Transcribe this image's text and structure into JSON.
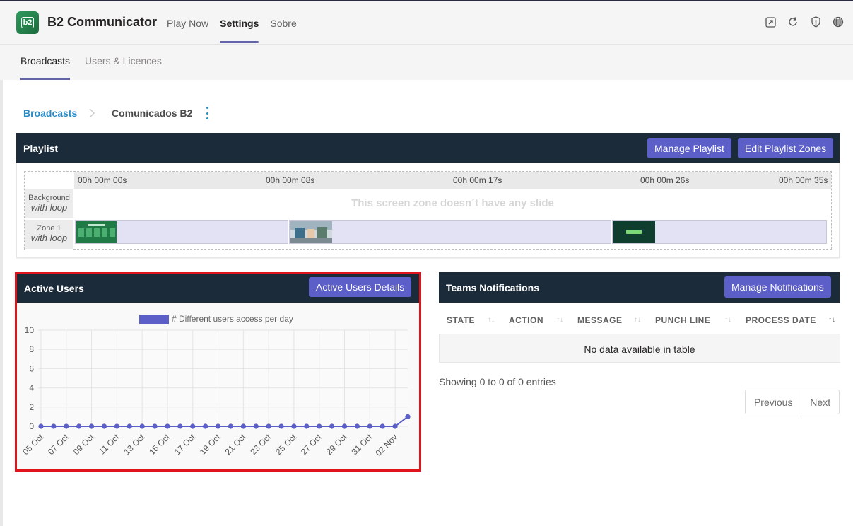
{
  "app": {
    "logo_text": "b2",
    "title": "B2 Communicator",
    "tabs": [
      "Play Now",
      "Settings",
      "Sobre"
    ],
    "active_tab": "Settings",
    "icons": [
      "popout-icon",
      "refresh-icon",
      "shield-icon",
      "globe-icon"
    ]
  },
  "subtabs": [
    "Broadcasts",
    "Users & Licences"
  ],
  "breadcrumb": {
    "root": "Broadcasts",
    "current": "Comunicados B2"
  },
  "playlist": {
    "title": "Playlist",
    "manage_label": "Manage Playlist",
    "edit_zones_label": "Edit Playlist Zones",
    "times": [
      "00h 00m 00s",
      "00h 00m 08s",
      "00h 00m 17s",
      "00h 00m 26s",
      "00h 00m 35s"
    ],
    "rows": [
      {
        "name": "Background",
        "mode": "with loop"
      },
      {
        "name": "Zone 1",
        "mode": "with loop"
      }
    ],
    "empty_message": "This screen zone doesn´t have any slide"
  },
  "active_users": {
    "title": "Active Users",
    "details_label": "Active Users Details"
  },
  "chart_data": {
    "type": "line",
    "title": "",
    "legend": [
      "# Different users access per day"
    ],
    "legend_position": "top",
    "xlabel": "",
    "ylabel": "",
    "ylim": [
      0,
      10
    ],
    "yticks": [
      0,
      2,
      4,
      6,
      8,
      10
    ],
    "grid": true,
    "color": "#5b5fc7",
    "x_tick_labels": [
      "05 Oct",
      "07 Oct",
      "09 Oct",
      "11 Oct",
      "13 Oct",
      "15 Oct",
      "17 Oct",
      "19 Oct",
      "21 Oct",
      "23 Oct",
      "25 Oct",
      "27 Oct",
      "29 Oct",
      "31 Oct",
      "02 Nov"
    ],
    "series": [
      {
        "name": "# Different users access per day",
        "x": [
          "05 Oct",
          "06 Oct",
          "07 Oct",
          "08 Oct",
          "09 Oct",
          "10 Oct",
          "11 Oct",
          "12 Oct",
          "13 Oct",
          "14 Oct",
          "15 Oct",
          "16 Oct",
          "17 Oct",
          "18 Oct",
          "19 Oct",
          "20 Oct",
          "21 Oct",
          "22 Oct",
          "23 Oct",
          "24 Oct",
          "25 Oct",
          "26 Oct",
          "27 Oct",
          "28 Oct",
          "29 Oct",
          "30 Oct",
          "31 Oct",
          "01 Nov",
          "02 Nov",
          "03 Nov"
        ],
        "values": [
          0,
          0,
          0,
          0,
          0,
          0,
          0,
          0,
          0,
          0,
          0,
          0,
          0,
          0,
          0,
          0,
          0,
          0,
          0,
          0,
          0,
          0,
          0,
          0,
          0,
          0,
          0,
          0,
          0,
          1
        ]
      }
    ]
  },
  "teams": {
    "title": "Teams Notifications",
    "manage_label": "Manage Notifications",
    "columns": [
      "STATE",
      "ACTION",
      "MESSAGE",
      "PUNCH LINE",
      "PROCESS DATE"
    ],
    "no_data": "No data available in table",
    "showing": "Showing 0 to 0 of 0 entries",
    "prev_label": "Previous",
    "next_label": "Next"
  }
}
